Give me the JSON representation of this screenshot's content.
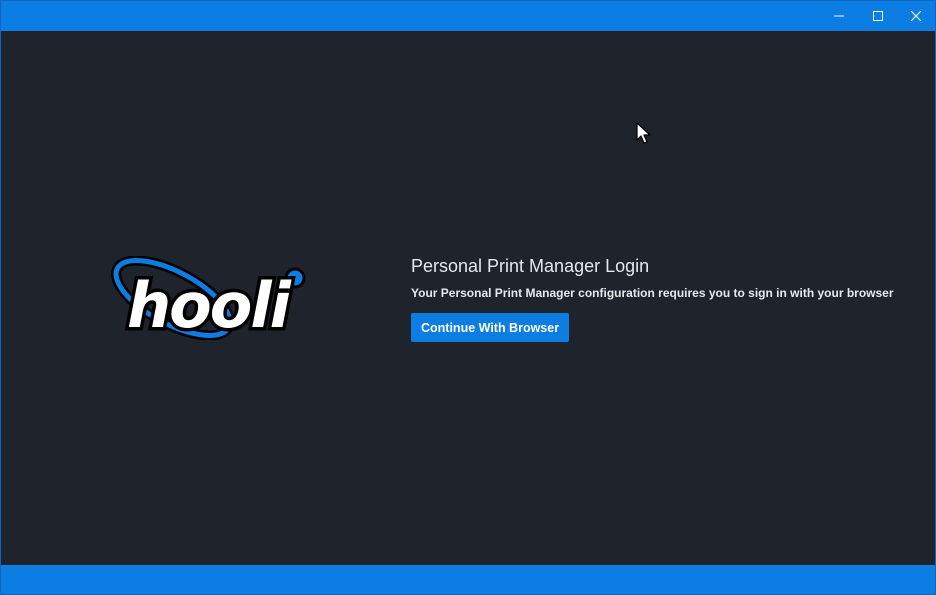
{
  "window": {
    "accent_color": "#0b7de3",
    "background_color": "#1e232c",
    "controls": {
      "minimize_icon": "minimize-icon",
      "maximize_icon": "maximize-icon",
      "close_icon": "close-icon"
    }
  },
  "logo": {
    "text": "hooli"
  },
  "login": {
    "title": "Personal Print Manager Login",
    "description": "Your Personal Print Manager configuration requires you to sign in with your browser",
    "button_label": "Continue With Browser"
  }
}
